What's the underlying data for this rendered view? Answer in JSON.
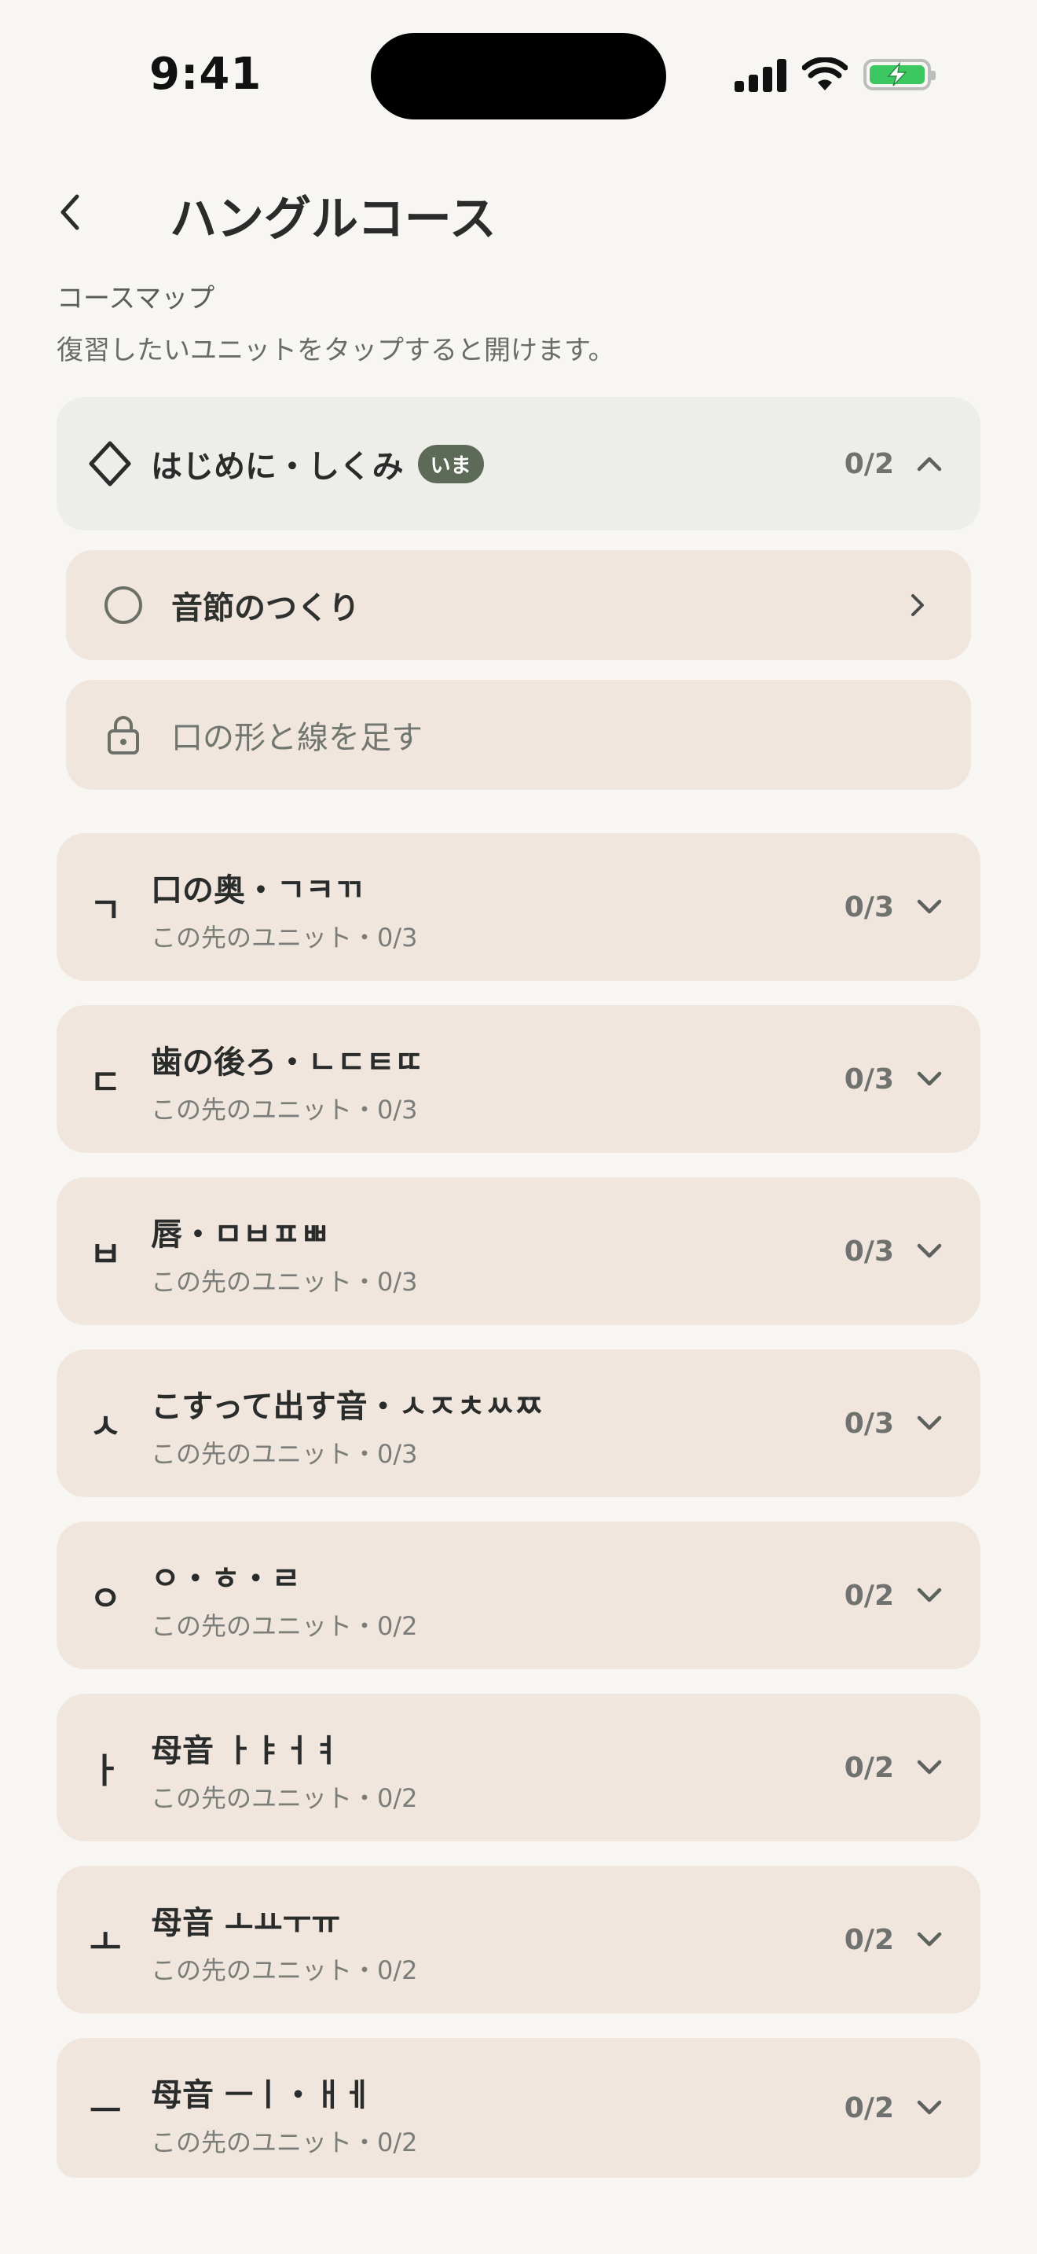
{
  "status_bar": {
    "time": "9:41"
  },
  "header": {
    "title": "ハングルコース"
  },
  "course_map": {
    "section_label": "コースマップ",
    "hint": "復習したいユニットをタップすると開けます。"
  },
  "current_unit": {
    "title": "はじめに・しくみ",
    "badge": "いま",
    "count": "0/2",
    "icon": "diamond-outline-icon",
    "expanded": true,
    "lessons": [
      {
        "label": "音節のつくり",
        "state": "available",
        "icon": "circle-outline-icon"
      },
      {
        "label": "口の形と線を足す",
        "state": "locked",
        "icon": "lock-icon"
      }
    ]
  },
  "units": [
    {
      "glyph": "ㄱ",
      "title": "口の奥・ㄱㅋㄲ",
      "subtitle": "この先のユニット・0/3",
      "count": "0/3"
    },
    {
      "glyph": "ㄷ",
      "title": "歯の後ろ・ㄴㄷㅌㄸ",
      "subtitle": "この先のユニット・0/3",
      "count": "0/3"
    },
    {
      "glyph": "ㅂ",
      "title": "唇・ㅁㅂㅍㅃ",
      "subtitle": "この先のユニット・0/3",
      "count": "0/3"
    },
    {
      "glyph": "ㅅ",
      "title": "こすって出す音・ㅅㅈㅊㅆㅉ",
      "subtitle": "この先のユニット・0/3",
      "count": "0/3"
    },
    {
      "glyph": "ㅇ",
      "title": "ㅇ・ㅎ・ㄹ",
      "subtitle": "この先のユニット・0/2",
      "count": "0/2"
    },
    {
      "glyph": "ㅏ",
      "title": "母音 ㅏㅑㅓㅕ",
      "subtitle": "この先のユニット・0/2",
      "count": "0/2"
    },
    {
      "glyph": "ㅗ",
      "title": "母音 ㅗㅛㅜㅠ",
      "subtitle": "この先のユニット・0/2",
      "count": "0/2"
    },
    {
      "glyph": "ㅡ",
      "title": "母音 ㅡㅣ・ㅐㅔ",
      "subtitle": "この先のユニット・0/2",
      "count": "0/2"
    }
  ],
  "colors": {
    "background": "#f7f6f3",
    "card": "#f0e6dd",
    "current_card": "#ededea",
    "badge": "#5e6a58",
    "battery": "#3cc760"
  }
}
